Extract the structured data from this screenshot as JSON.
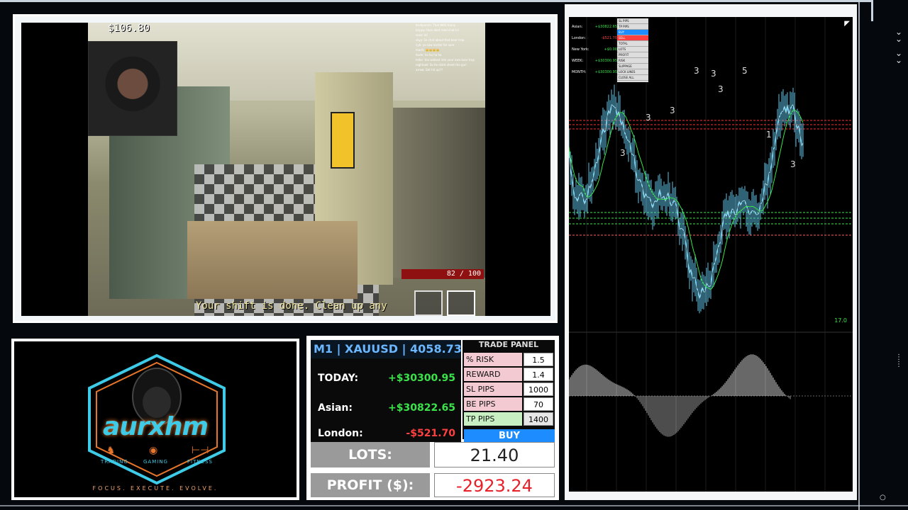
{
  "game": {
    "cash": "$106.80",
    "subtitle": "Your shift is done. Clean up any",
    "health": "82 / 100",
    "chat": [
      "bruhpunch: That WAS funny",
      "brippy: then dont read chat lol",
      "xoxo: lol",
      "skyy: So chat about that bear trap",
      "cyb: yo saw earlier for sure",
      "mach: 👑👑👑👑",
      "dude: ha ha ha ha",
      "mike: You walked into your own bear trap",
      "nightowl: So he didnt sheet the gun",
      "arrow: Get hit up!!!"
    ]
  },
  "logo": {
    "wordmark": "aurxhm",
    "categories": [
      "TRADING",
      "GAMING",
      "FITNESS"
    ],
    "tagline": "FOCUS. EXECUTE. EVOLVE."
  },
  "trading": {
    "symbol": "M1 | XAUUSD | 4058.73",
    "today": {
      "label": "TODAY:",
      "value": "+$30300.95"
    },
    "asian": {
      "label": "Asian:",
      "value": "+$30822.65"
    },
    "london": {
      "label": "London:",
      "value": "-$521.70"
    },
    "lots": {
      "label": "LOTS:",
      "value": "21.40"
    },
    "profit": {
      "label": "PROFIT ($):",
      "value": "-2923.24"
    }
  },
  "trade_panel": {
    "title": "TRADE PANEL",
    "rows": [
      {
        "label": "% RISK",
        "value": "1.5",
        "color": "#f3c9d2"
      },
      {
        "label": "REWARD",
        "value": "1.4",
        "color": "#f3c9d2"
      },
      {
        "label": "SL PIPS",
        "value": "1000",
        "color": "#f3c9d2"
      },
      {
        "label": "BE PIPS",
        "value": "70",
        "color": "#f3c9d2"
      },
      {
        "label": "TP PIPS",
        "value": "1400",
        "color": "#c8efc2"
      }
    ],
    "buy_label": "BUY"
  },
  "chart": {
    "mini_stats": [
      {
        "label": "Asian:",
        "value": "+$30822.65"
      },
      {
        "label": "London:",
        "value": "-$521.70"
      },
      {
        "label": "New York:",
        "value": "+$0.00"
      },
      {
        "label": "WEEK:",
        "value": "+$30300.95"
      },
      {
        "label": "MONTH:",
        "value": "+$30300.95"
      }
    ],
    "mini_panel": [
      "SL PIPS",
      "TP PIPS",
      "BUY",
      "SELL",
      "TOTAL",
      "LOTS",
      "PROFIT",
      "RISK",
      "SLIPPAGE",
      "LOCK LINES",
      "CLOSE ALL"
    ],
    "wave_labels": [
      "3",
      "3",
      "3",
      "3",
      "3",
      "5",
      "1",
      "3",
      "3"
    ],
    "price_label": "17.0",
    "colors": {
      "bull": "#3be34b",
      "bear": "#ff4040",
      "accent": "#1c8cff"
    }
  }
}
